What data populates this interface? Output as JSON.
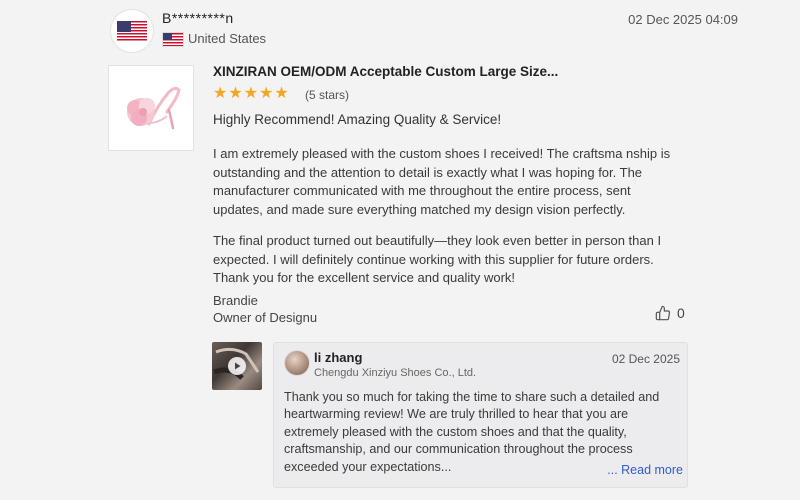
{
  "review": {
    "username": "B*********n",
    "country": "United States",
    "date": "02 Dec 2025 04:09",
    "product_title": "XINZIRAN OEM/ODM Acceptable Custom Large Size...",
    "rating": 5,
    "rating_label": "(5 stars)",
    "headline": "Highly Recommend! Amazing Quality & Service!",
    "paragraphs": [
      "I am extremely pleased with the custom shoes I received! The craftsma nship is outstanding and the attention to detail is exactly what I was hoping for. The manufacturer communicated with me throughout the entire process, sent updates, and made sure everything matched my design vision perfectly.",
      "The final product turned out beautifully—they look even better in person than I expected. I will definitely continue working with this supplier for future orders. Thank you for the excellent service and quality work!"
    ],
    "signature_name": "Brandie",
    "signature_title": "Owner of Designu",
    "likes": "0"
  },
  "reply": {
    "name": "li zhang",
    "company": "Chengdu Xinziyu Shoes Co., Ltd.",
    "date": "02 Dec 2025",
    "text": "Thank you so much for taking the time to share such a detailed and heartwarming review! We are truly thrilled to hear that you are extremely pleased with the custom shoes and that the quality, craftsmanship, and our communication throughout the process exceeded your expectations...",
    "read_more_prefix": "...",
    "read_more": "Read more"
  },
  "colors": {
    "star": "#f5a623",
    "link": "#2f5bd1",
    "flag_red": "#c8102e",
    "flag_blue": "#3c3b6e"
  },
  "icons": {
    "avatar": "us-flag-icon",
    "country": "us-flag-icon",
    "like": "thumbs-up-icon",
    "video": "play-icon"
  }
}
